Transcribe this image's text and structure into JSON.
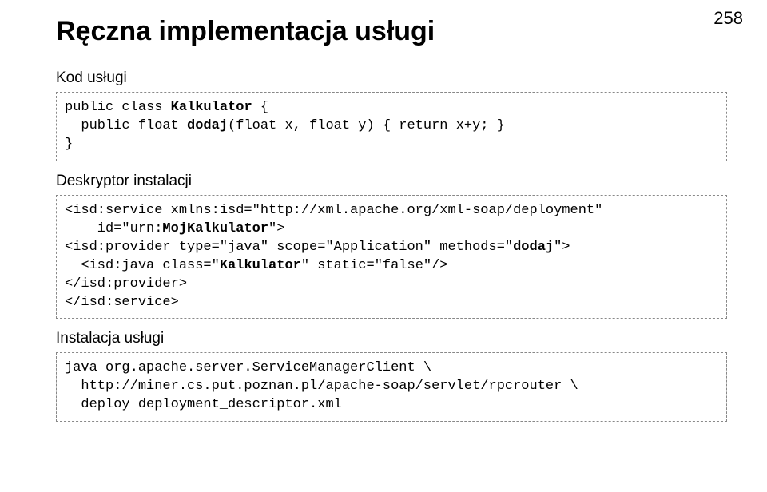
{
  "page_number": "258",
  "title": "Ręczna implementacja usługi",
  "sections": {
    "code_service": {
      "label": "Kod usługi",
      "line1a": "public class ",
      "line1b": "Kalkulator",
      "line1c": " {",
      "line2a": "  public float ",
      "line2b": "dodaj",
      "line2c": "(float x, float y) { return x+y; }",
      "line3": "}"
    },
    "descriptor": {
      "label": "Deskryptor instalacji",
      "line1": "<isd:service xmlns:isd=\"http://xml.apache.org/xml-soap/deployment\"",
      "line2a": "    id=\"urn:",
      "line2b": "MojKalkulator",
      "line2c": "\">",
      "line3a": "<isd:provider type=\"java\" scope=\"Application\" methods=\"",
      "line3b": "dodaj",
      "line3c": "\">",
      "line4a": "  <isd:java class=\"",
      "line4b": "Kalkulator",
      "line4c": "\" static=\"false\"/>",
      "line5": "</isd:provider>",
      "line6": "</isd:service>"
    },
    "install": {
      "label": "Instalacja usługi",
      "line1": "java org.apache.server.ServiceManagerClient \\",
      "line2": "  http://miner.cs.put.poznan.pl/apache-soap/servlet/rpcrouter \\",
      "line3": "  deploy deployment_descriptor.xml"
    }
  }
}
